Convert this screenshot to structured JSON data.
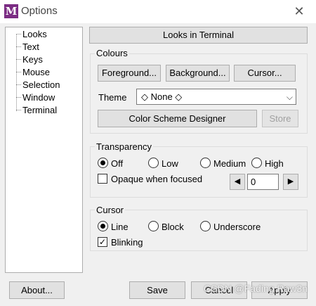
{
  "window": {
    "title": "Options",
    "app_icon_letter": "M"
  },
  "tree": {
    "items": [
      "Looks",
      "Text",
      "Keys",
      "Mouse",
      "Selection",
      "Window",
      "Terminal"
    ]
  },
  "panel": {
    "header": "Looks in Terminal"
  },
  "colours": {
    "title": "Colours",
    "foreground": "Foreground...",
    "background": "Background...",
    "cursor": "Cursor...",
    "theme_label": "Theme",
    "theme_value": "◇ None ◇",
    "scheme_designer": "Color Scheme Designer",
    "store": "Store"
  },
  "transparency": {
    "title": "Transparency",
    "options": [
      "Off",
      "Low",
      "Medium",
      "High"
    ],
    "selected": "Off",
    "opaque_label": "Opaque when focused",
    "opaque_checked": false,
    "value": "0"
  },
  "cursor": {
    "title": "Cursor",
    "options": [
      "Line",
      "Block",
      "Underscore"
    ],
    "selected": "Line",
    "blinking_label": "Blinking",
    "blinking_checked": true
  },
  "buttons": {
    "about": "About...",
    "save": "Save",
    "cancel": "Cancel",
    "apply": "Apply"
  },
  "watermark": "CSDN @Fading Raw3n",
  "colors": {
    "app_icon_bg": "#7b2c83",
    "window_bg": "#f0f0f0"
  }
}
